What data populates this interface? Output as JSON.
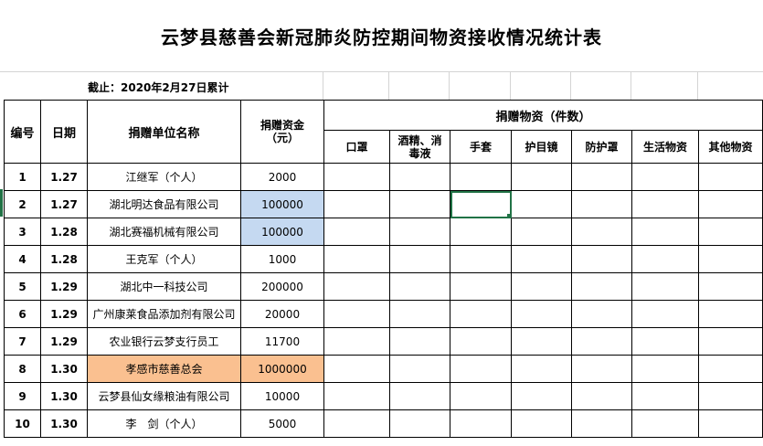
{
  "title": "云梦县慈善会新冠肺炎防控期间物资接收情况统计表",
  "cutoff": "截止：2020年2月27日累计",
  "headers": {
    "no": "编号",
    "date": "日期",
    "unit": "捐赠单位名称",
    "funds": "捐赠资金（元）",
    "supplies": "捐赠物资（件数）",
    "sub": [
      "口罩",
      "酒精、消毒液",
      "手套",
      "护目镜",
      "防护罩",
      "生活物资",
      "其他物资"
    ]
  },
  "rows": [
    {
      "no": "1",
      "date": "1.27",
      "unit": "江继军（个人）",
      "funds": "2000"
    },
    {
      "no": "2",
      "date": "1.27",
      "unit": "湖北明达食品有限公司",
      "funds": "100000"
    },
    {
      "no": "3",
      "date": "1.28",
      "unit": "湖北赛福机械有限公司",
      "funds": "100000"
    },
    {
      "no": "4",
      "date": "1.28",
      "unit": "王克军（个人）",
      "funds": "1000"
    },
    {
      "no": "5",
      "date": "1.29",
      "unit": "湖北中一科技公司",
      "funds": "200000"
    },
    {
      "no": "6",
      "date": "1.29",
      "unit": "广州康莱食品添加剂有限公司",
      "funds": "20000"
    },
    {
      "no": "7",
      "date": "1.29",
      "unit": "农业银行云梦支行员工",
      "funds": "11700"
    },
    {
      "no": "8",
      "date": "1.30",
      "unit": "孝感市慈善总会",
      "funds": "1000000"
    },
    {
      "no": "9",
      "date": "1.30",
      "unit": "云梦县仙女缘粮油有限公司",
      "funds": "10000"
    },
    {
      "no": "10",
      "date": "1.30",
      "unit": "李　剑（个人）",
      "funds": "5000"
    }
  ],
  "colors": {
    "highlight_blue": "#c5d9f1",
    "highlight_orange": "#fac090",
    "selection_green": "#217346"
  }
}
